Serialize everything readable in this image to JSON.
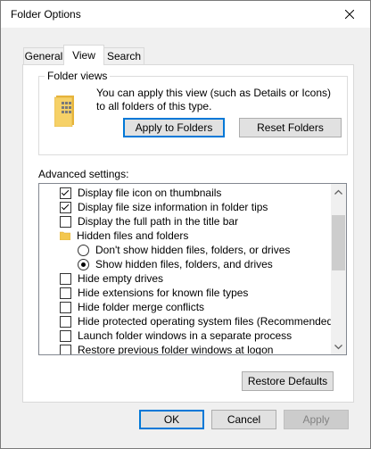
{
  "window": {
    "title": "Folder Options"
  },
  "tabs": [
    "General",
    "View",
    "Search"
  ],
  "folder_views": {
    "legend": "Folder views",
    "description": "You can apply this view (such as Details or Icons) to all folders of this type.",
    "apply_button": "Apply to Folders",
    "reset_button": "Reset Folders"
  },
  "advanced": {
    "label": "Advanced settings:",
    "items": [
      {
        "type": "checkbox",
        "label": "Display file icon on thumbnails",
        "checked": true
      },
      {
        "type": "checkbox",
        "label": "Display file size information in folder tips",
        "checked": true
      },
      {
        "type": "checkbox",
        "label": "Display the full path in the title bar",
        "checked": false
      },
      {
        "type": "folder",
        "label": "Hidden files and folders"
      },
      {
        "type": "radio",
        "label": "Don't show hidden files, folders, or drives",
        "checked": false
      },
      {
        "type": "radio",
        "label": "Show hidden files, folders, and drives",
        "checked": true
      },
      {
        "type": "checkbox",
        "label": "Hide empty drives",
        "checked": false
      },
      {
        "type": "checkbox",
        "label": "Hide extensions for known file types",
        "checked": false
      },
      {
        "type": "checkbox",
        "label": "Hide folder merge conflicts",
        "checked": false
      },
      {
        "type": "checkbox",
        "label": "Hide protected operating system files (Recommended)",
        "checked": false
      },
      {
        "type": "checkbox",
        "label": "Launch folder windows in a separate process",
        "checked": false
      },
      {
        "type": "checkbox",
        "label": "Restore previous folder windows at logon",
        "checked": false
      }
    ],
    "restore_button": "Restore Defaults"
  },
  "dialog_buttons": {
    "ok": "OK",
    "cancel": "Cancel",
    "apply": "Apply"
  },
  "colors": {
    "accent": "#0078d7",
    "folder": "#f3c74f"
  }
}
